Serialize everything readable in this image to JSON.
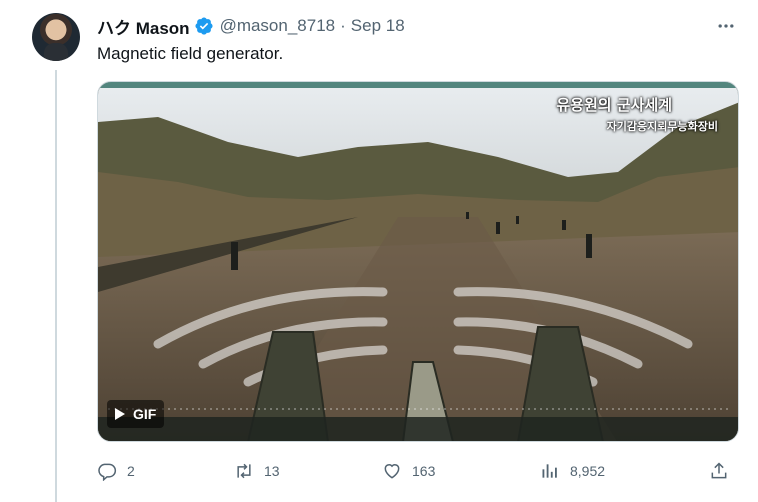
{
  "tweet": {
    "display_name": "ハク Mason",
    "handle": "@mason_8718",
    "separator": "·",
    "date": "Sep 18",
    "text": "Magnetic field generator.",
    "verified": true
  },
  "media": {
    "type": "gif",
    "badge_label": "GIF",
    "overlay_title": "유용원의 군사세계",
    "overlay_url": "http://bemil.chosun.com",
    "overlay_subtitle": "자기감응지뢰무능화장비"
  },
  "actions": {
    "replies": "2",
    "retweets": "13",
    "likes": "163",
    "views": "8,952"
  },
  "colors": {
    "text_primary": "#0f1419",
    "text_secondary": "#536471",
    "verified_badge": "#1d9bf0",
    "border": "#cfd9de"
  },
  "icons": [
    "verified-badge-icon",
    "more-icon",
    "play-icon",
    "reply-icon",
    "retweet-icon",
    "like-icon",
    "views-icon",
    "share-icon"
  ]
}
